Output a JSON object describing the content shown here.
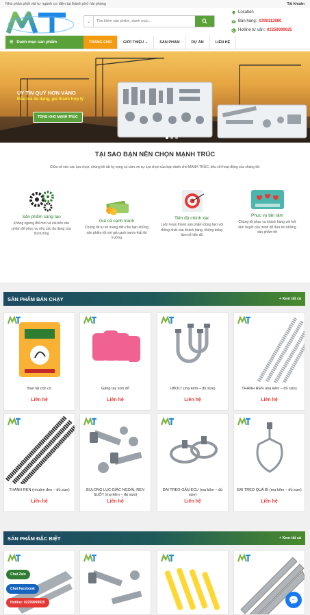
{
  "topbar": {
    "tagline": "Nhà phân phối vật tư ngành cơ điện tại thành phố hải phòng",
    "account": "Tài khoản"
  },
  "header": {
    "logo_text": "MT",
    "search_placeholder": "Tìm kiếm sản phẩm, danh mục...",
    "location": "Location",
    "sales_label": "Bán hàng:",
    "sales_phone": "0398112880",
    "hotline_label": "Hotline tư vấn:",
    "hotline_phone": "02259999925"
  },
  "nav": {
    "category_btn": "Danh mục sản phẩm",
    "items": [
      "TRANG CHỦ",
      "GIỚI THIỆU",
      "SẢN PHẨM",
      "DỰ ÁN",
      "LIÊN HỆ"
    ]
  },
  "banner": {
    "slogan1": "UY TÍN QUÝ HƠN VÀNG",
    "slogan2": "Mẫu mã đa dạng, giá thành hợp lý",
    "button": "TỔNG KHO MẠNH TRÚC"
  },
  "why": {
    "title": "TẠI SAO BẠN NÊN CHỌN MẠNH TRÚC",
    "intro": "Giữa vô vàn các lựa chọn, chúng tôi rất hy vọng và cảm ơn sự lựa chọn của bạn dành cho MẠNH TRÚC, tiêu chí hoạt động của chúng tôi:",
    "features": [
      {
        "title": "Sản phẩm sáng tạo",
        "desc": "Không ngừng đổi mới và cải tiến sản phẩm để phục vụ nhu cầu đa dạng của thị trường",
        "icon": "gears-icon"
      },
      {
        "title": "Giá cả cạnh tranh",
        "desc": "Chúng tôi tự tin mang đến cho bạn những sản phẩm tốt với giá cạnh tranh nhất thị trường",
        "icon": "money-icon"
      },
      {
        "title": "Tiến độ chính xác",
        "desc": "Luôn hoàn thành sản phẩm đúng hẹn với thông nhất của khách hàng, không delay làm trễ tiến độ",
        "icon": "target-icon"
      },
      {
        "title": "Phục vụ tận tâm",
        "desc": "Chúng tôi phục vụ khách hàng với hết tâm huyết của mình để đưa tới những sản phẩm tốt",
        "icon": "hearts-icon"
      }
    ]
  },
  "sections": [
    {
      "title": "SẢN PHẨM BÁN CHẠY",
      "more": "+ Xem tất cả"
    },
    {
      "title": "SẢN PHẨM ĐẶC BIỆT",
      "more": "+ Xem tất cả"
    }
  ],
  "products": [
    {
      "name": "Bao tải con cò",
      "price": "Liên hệ",
      "kind": "bag"
    },
    {
      "name": "Găng tay sơn đỏ",
      "price": "Liên hệ",
      "kind": "gloves"
    },
    {
      "name": "UBOLT (mạ kẽm – đủ size)",
      "price": "Liên hệ",
      "kind": "ubolt"
    },
    {
      "name": "THANH REN (mạ kẽm – đủ size)",
      "price": "Liên hệ",
      "kind": "rods"
    },
    {
      "name": "THANH REN (nhuộm đen – đủ size)",
      "price": "Liên hệ",
      "kind": "blackrods"
    },
    {
      "name": "BULONG LỤC GIÁC NGOÀI, REN SUỐT (mạ kẽm – đủ size)",
      "price": "Liên hệ",
      "kind": "bolts"
    },
    {
      "name": "ĐAI TREO GẮN ECU (mạ kẽm – đủ size)",
      "price": "Liên hệ",
      "kind": "clamps"
    },
    {
      "name": "ĐAI TREO QUẢ BÍ (mạ kẽm – đủ size)",
      "price": "Liên hệ",
      "kind": "hanger"
    }
  ],
  "special": [
    {
      "kind": "channel"
    },
    {
      "kind": "bolts2"
    },
    {
      "kind": "anchors"
    },
    {
      "kind": "angle"
    }
  ],
  "floaters": {
    "zalo": "Chat Zalo",
    "facebook": "Chat Facebook",
    "hotline": "Hotline: 02259999925"
  },
  "colors": {
    "green": "#5aa13a",
    "orange": "#f39c12",
    "red": "#e53935",
    "navy": "#1d4a63"
  }
}
